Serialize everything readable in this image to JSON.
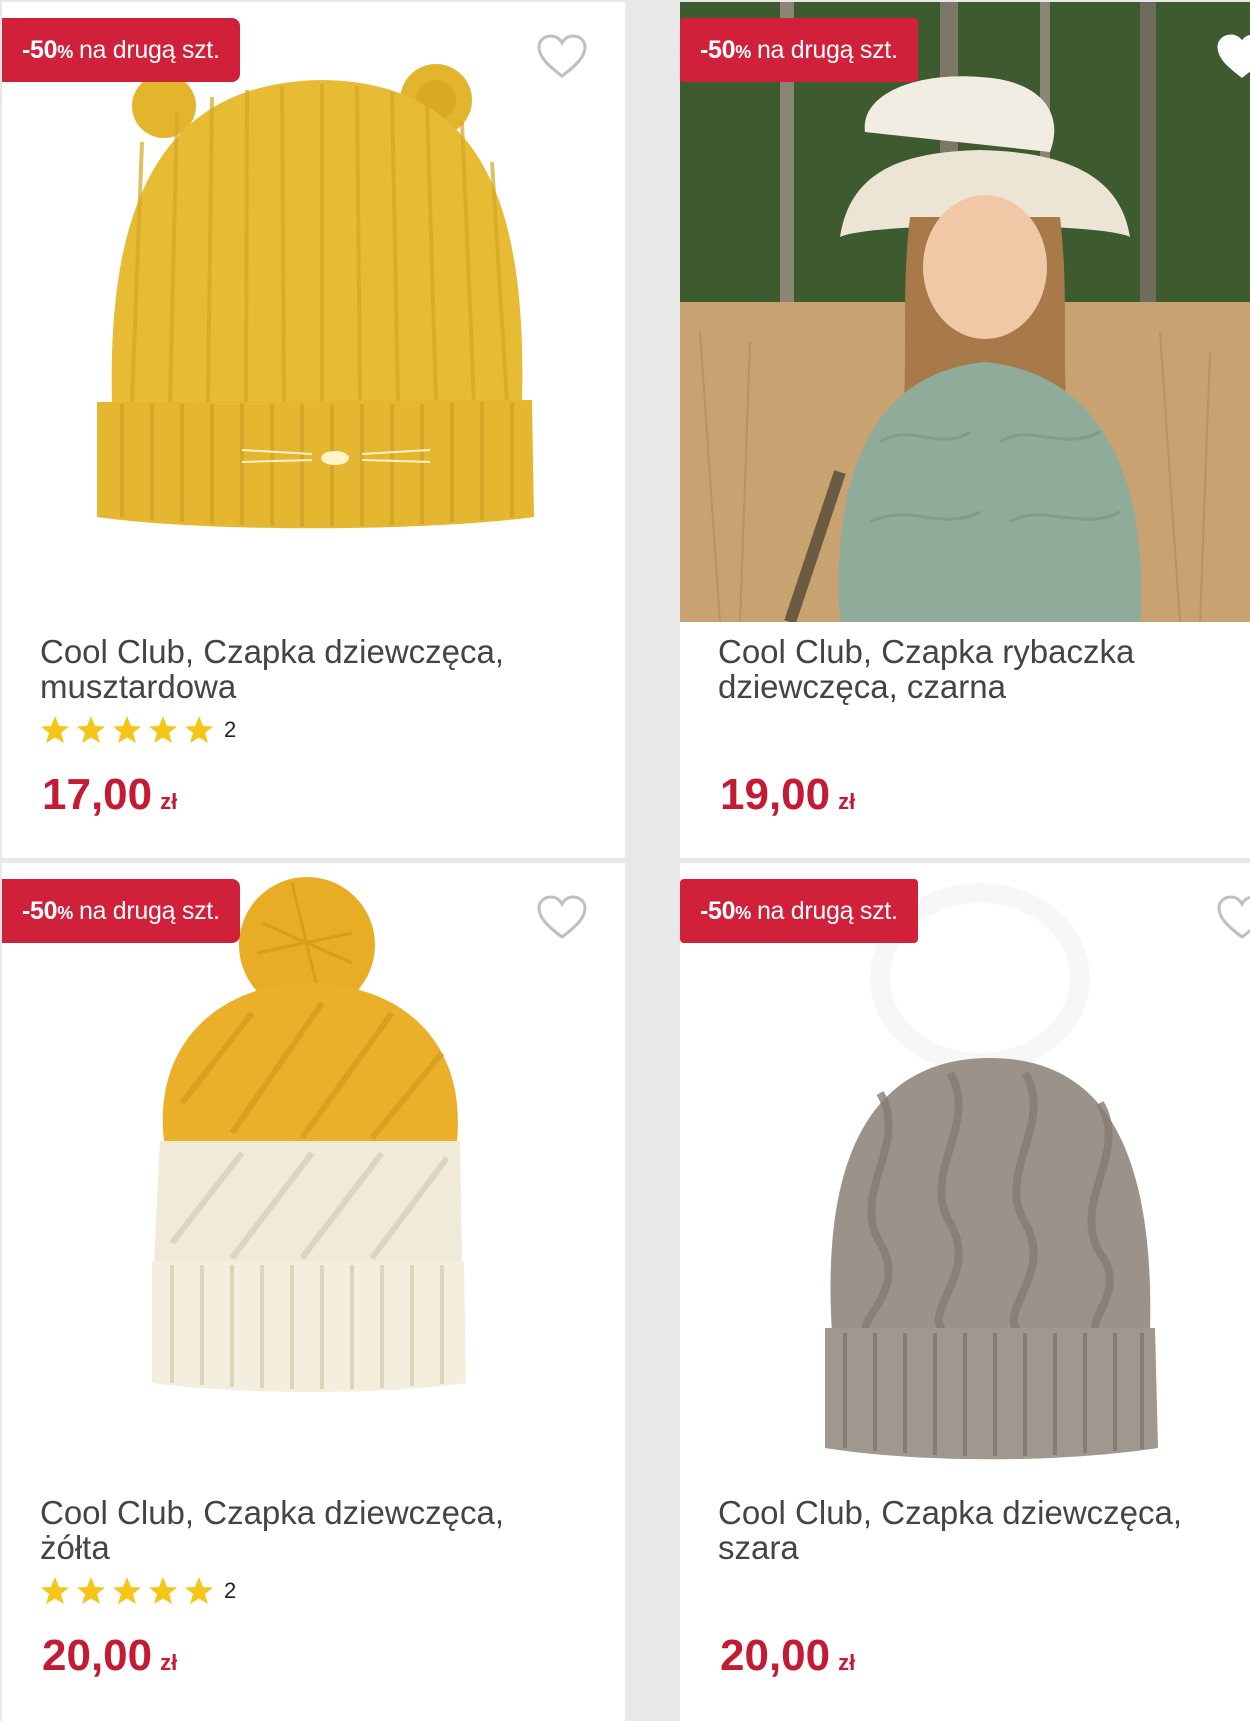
{
  "products": [
    {
      "badge": {
        "percent": "-50",
        "pct_sign": "%",
        "text": "na drugą szt."
      },
      "title": "Cool Club, Czapka dziewczęca, musztardowa",
      "rating": {
        "stars": 5,
        "count": "2"
      },
      "price": "17,00",
      "currency": "zł",
      "image": "mustard-cat-beanie"
    },
    {
      "badge": {
        "percent": "-50",
        "pct_sign": "%",
        "text": "na drugą szt."
      },
      "title": "Cool Club, Czapka rybaczka dziewczęca, czarna",
      "price": "19,00",
      "currency": "zł",
      "image": "girl-bucket-hat-photo"
    },
    {
      "badge": {
        "percent": "-50",
        "pct_sign": "%",
        "text": "na drugą szt."
      },
      "title": "Cool Club, Czapka dziewczęca, żółta",
      "rating": {
        "stars": 5,
        "count": "2"
      },
      "price": "20,00",
      "currency": "zł",
      "image": "yellow-cream-pompom-beanie"
    },
    {
      "badge": {
        "percent": "-50",
        "pct_sign": "%",
        "text": "na drugą szt."
      },
      "title": "Cool Club, Czapka dziewczęca, szara",
      "price": "20,00",
      "currency": "zł",
      "image": "grey-cable-pompom-beanie"
    }
  ],
  "colors": {
    "badge_bg": "#d0203a",
    "price": "#c41b35",
    "star": "#f5c518",
    "title": "#444444"
  },
  "icons": {
    "favorite": "heart-outline-icon",
    "rating": "star-icon"
  }
}
